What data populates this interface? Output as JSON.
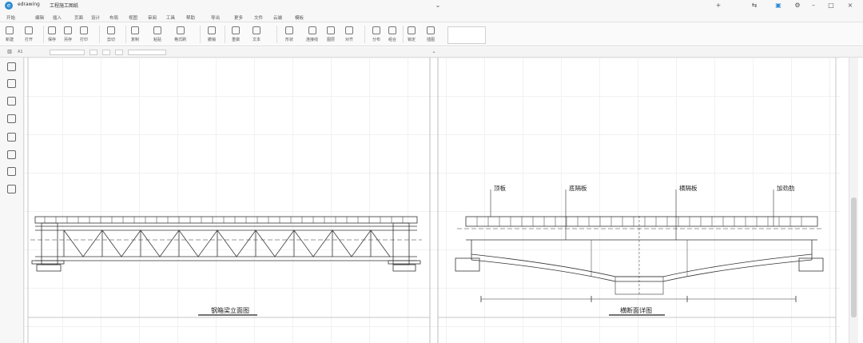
{
  "app": {
    "name": "edrawing",
    "document_title": "工程施工图纸"
  },
  "menu": [
    "开始",
    "编辑",
    "插入",
    "页面",
    "设计",
    "布局",
    "视图",
    "审阅",
    "工具",
    "帮助",
    "导出",
    "更多",
    "文件",
    "云端",
    "模板"
  ],
  "ribbon": {
    "tools": [
      "新建",
      "打开",
      "保存",
      "另存",
      "打印",
      "剪切",
      "复制",
      "粘贴",
      "格式刷",
      "撤销",
      "重做",
      "文本",
      "形状",
      "连接线",
      "图层",
      "对齐",
      "分布",
      "组合",
      "锁定",
      "插图"
    ]
  },
  "formula_bar": {
    "cell_ref": "A1"
  },
  "sidebar": {
    "tools": [
      "layers-icon",
      "list-icon",
      "pen-icon",
      "bucket-icon",
      "shape-icon",
      "stack-icon",
      "grid-icon",
      "theme-icon"
    ]
  },
  "drawing": {
    "left_view": {
      "caption": "钢箱梁立面图"
    },
    "right_view": {
      "caption": "横断面详图",
      "callouts": {
        "top_plate": "顶板",
        "bottom_plate": "底隔板",
        "diaphragm": "横隔板",
        "stiffener": "加劲肋"
      }
    }
  }
}
